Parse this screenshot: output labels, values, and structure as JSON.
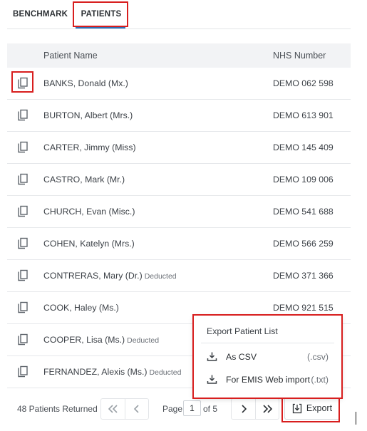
{
  "tabs": {
    "benchmark": "BENCHMARK",
    "patients": "PATIENTS"
  },
  "table": {
    "headers": {
      "name": "Patient Name",
      "nhs": "NHS Number"
    },
    "rows": [
      {
        "name": "BANKS, Donald (Mx.)",
        "deducted": "",
        "nhs": "DEMO 062 598"
      },
      {
        "name": "BURTON, Albert (Mrs.)",
        "deducted": "",
        "nhs": "DEMO 613 901"
      },
      {
        "name": "CARTER, Jimmy (Miss)",
        "deducted": "",
        "nhs": "DEMO 145 409"
      },
      {
        "name": "CASTRO, Mark (Mr.)",
        "deducted": "",
        "nhs": "DEMO 109 006"
      },
      {
        "name": "CHURCH, Evan (Misc.)",
        "deducted": "",
        "nhs": "DEMO 541 688"
      },
      {
        "name": "COHEN, Katelyn (Mrs.)",
        "deducted": "",
        "nhs": "DEMO 566 259"
      },
      {
        "name": "CONTRERAS, Mary (Dr.)",
        "deducted": "Deducted",
        "nhs": "DEMO 371 366"
      },
      {
        "name": "COOK, Haley (Ms.)",
        "deducted": "",
        "nhs": "DEMO 921 515"
      },
      {
        "name": "COOPER, Lisa (Ms.)",
        "deducted": "Deducted",
        "nhs": ""
      },
      {
        "name": "FERNANDEZ, Alexis (Ms.)",
        "deducted": "Deducted",
        "nhs": ""
      }
    ]
  },
  "footer": {
    "returned": "48 Patients Returned",
    "page_label": "Page",
    "page_value": "1",
    "of_label": "of 5",
    "export_label": "Export"
  },
  "export_popup": {
    "title": "Export Patient List",
    "items": [
      {
        "label": "As CSV",
        "ext": "(.csv)"
      },
      {
        "label": "For EMIS Web import",
        "ext": "(.txt)"
      }
    ]
  },
  "colors": {
    "accent": "#2f6fb5",
    "highlight_box": "#d81e1e",
    "header_bg": "#f2f3f5"
  }
}
